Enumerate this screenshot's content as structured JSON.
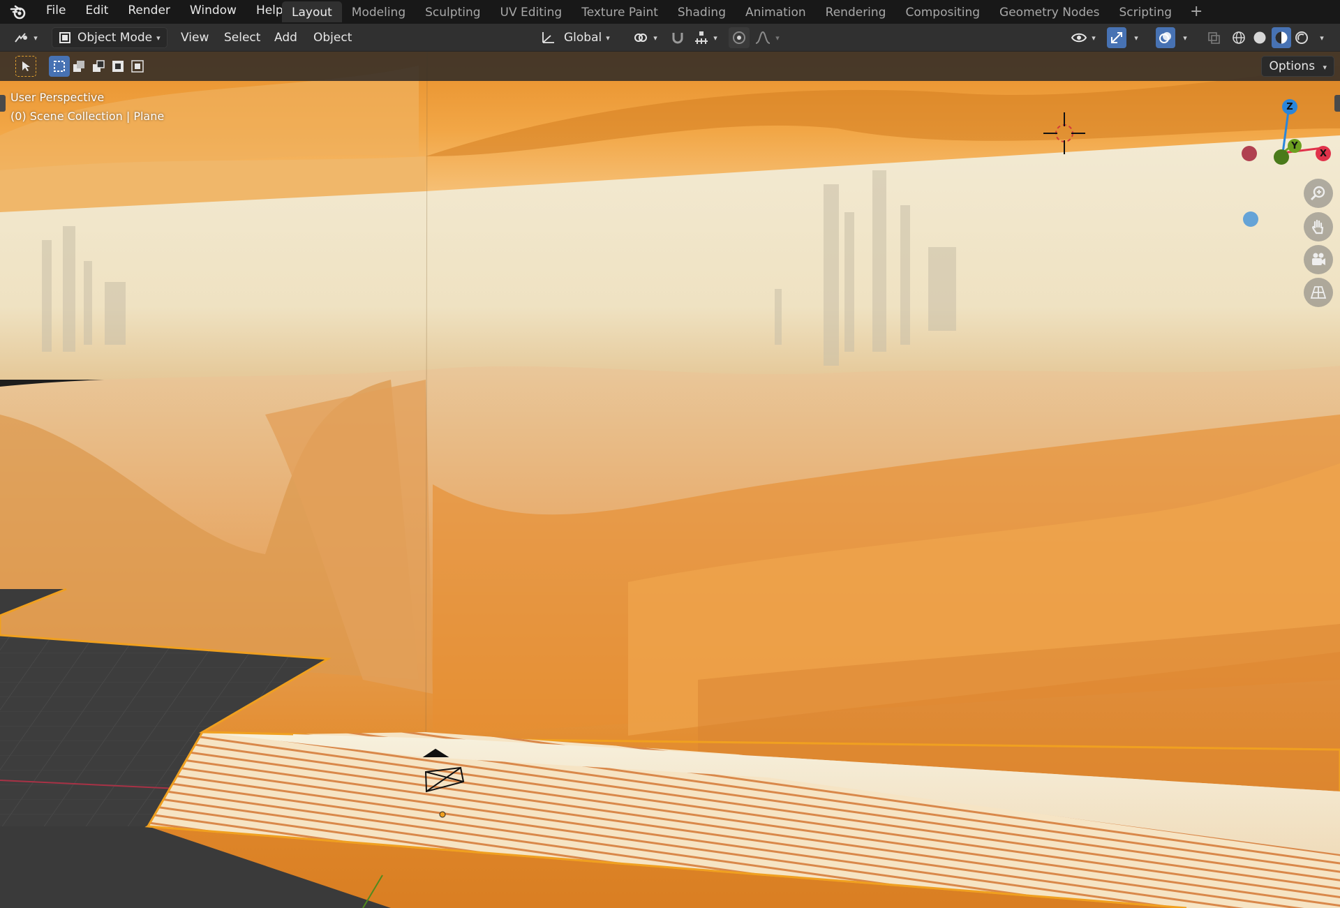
{
  "app": {
    "logo_icon": "blender-logo-icon"
  },
  "menubar": {
    "items": [
      {
        "label": "File"
      },
      {
        "label": "Edit"
      },
      {
        "label": "Render"
      },
      {
        "label": "Window"
      },
      {
        "label": "Help"
      }
    ]
  },
  "workspaces": {
    "tabs": [
      {
        "label": "Layout",
        "active": true
      },
      {
        "label": "Modeling"
      },
      {
        "label": "Sculpting"
      },
      {
        "label": "UV Editing"
      },
      {
        "label": "Texture Paint"
      },
      {
        "label": "Shading"
      },
      {
        "label": "Animation"
      },
      {
        "label": "Rendering"
      },
      {
        "label": "Compositing"
      },
      {
        "label": "Geometry Nodes"
      },
      {
        "label": "Scripting"
      }
    ],
    "add_icon": "plus-icon"
  },
  "header": {
    "mode": "Object Mode",
    "menus": [
      "View",
      "Select",
      "Add",
      "Object"
    ],
    "transform_orientation": "Global"
  },
  "viewport": {
    "perspective_label": "User Perspective",
    "collection_label": "(0) Scene Collection | Plane",
    "options_label": "Options",
    "gizmo": {
      "x": "X",
      "y": "Y",
      "z": "Z"
    },
    "colors": {
      "accent_blue": "#4772b3",
      "axis_x": "#e0324a",
      "axis_y": "#6da020",
      "axis_z": "#2a86db",
      "selection_orange": "#f0a020"
    }
  }
}
